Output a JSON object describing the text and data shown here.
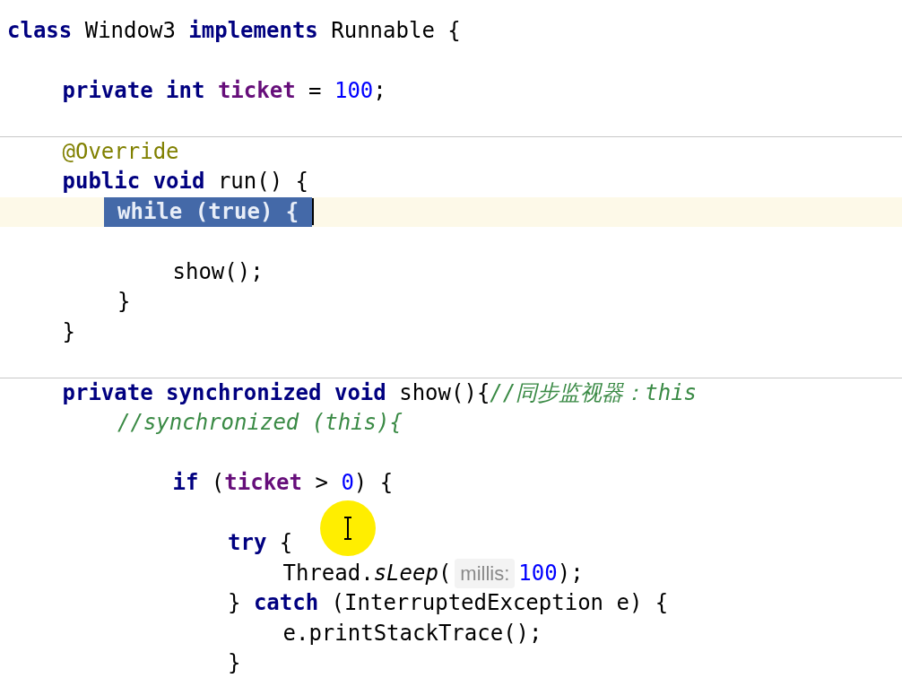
{
  "editor": {
    "lines": [
      {
        "current": false,
        "separator": false,
        "tokens": [
          {
            "t": "class",
            "kind": "keyword"
          },
          {
            "t": " Window3 ",
            "kind": "plain"
          },
          {
            "t": "implements",
            "kind": "keyword"
          },
          {
            "t": " Runnable {",
            "kind": "plain"
          }
        ],
        "children": [
          {
            "current": false,
            "separator": false
          },
          {
            "current": false,
            "separator": false,
            "tokens": [
              {
                "t": "private int ",
                "kind": "keyword"
              },
              {
                "t": "ticket",
                "kind": "field"
              },
              {
                "t": " = ",
                "kind": "plain"
              },
              {
                "t": "100",
                "kind": "number"
              },
              {
                "t": ";",
                "kind": "plain"
              }
            ]
          },
          {
            "current": false,
            "separator": false
          },
          {
            "current": false,
            "separator": true,
            "tokens": [
              {
                "t": "@Override",
                "kind": "annotation"
              }
            ]
          },
          {
            "current": false,
            "separator": false,
            "tokens": [
              {
                "t": "public void",
                "kind": "keyword"
              },
              {
                "t": " run() {",
                "kind": "plain"
              }
            ],
            "children": [
              {
                "current": true,
                "separator": false,
                "tokens": [
                  {
                    "t": "while (true) {",
                    "kind": "selected"
                  }
                ],
                "children": [
                  {
                    "current": false,
                    "separator": false
                  },
                  {
                    "current": false,
                    "separator": false,
                    "tokens": [
                      {
                        "t": "show();",
                        "kind": "plain"
                      }
                    ]
                  }
                ]
              },
              {
                "current": false,
                "separator": false,
                "tokens": [
                  {
                    "t": "}",
                    "kind": "plain"
                  }
                ]
              }
            ]
          },
          {
            "current": false,
            "separator": false,
            "tokens": [
              {
                "t": "}",
                "kind": "plain"
              }
            ]
          },
          {
            "current": false,
            "separator": false
          },
          {
            "current": false,
            "separator": true,
            "tokens": [
              {
                "t": "private synchronized void",
                "kind": "keyword"
              },
              {
                "t": " show(){",
                "kind": "plain"
              },
              {
                "t": "//同步监视器：this",
                "kind": "comment"
              }
            ],
            "children": [
              {
                "current": false,
                "separator": false,
                "tokens": [
                  {
                    "t": "//synchronized (this){",
                    "kind": "comment"
                  }
                ],
                "children": [
                  {
                    "current": false,
                    "separator": false
                  },
                  {
                    "current": false,
                    "separator": false,
                    "tokens": [
                      {
                        "t": "if",
                        "kind": "keyword"
                      },
                      {
                        "t": " (",
                        "kind": "plain"
                      },
                      {
                        "t": "ticket",
                        "kind": "field"
                      },
                      {
                        "t": " > ",
                        "kind": "plain"
                      },
                      {
                        "t": "0",
                        "kind": "number"
                      },
                      {
                        "t": ") {",
                        "kind": "plain"
                      }
                    ],
                    "children": [
                      {
                        "current": false,
                        "separator": false
                      },
                      {
                        "current": false,
                        "separator": false,
                        "tokens": [
                          {
                            "t": "try",
                            "kind": "keyword"
                          },
                          {
                            "t": " {",
                            "kind": "plain"
                          }
                        ],
                        "children": [
                          {
                            "current": false,
                            "separator": false,
                            "tokens": [
                              {
                                "t": "Thread.",
                                "kind": "plain"
                              },
                              {
                                "t": "sLeep",
                                "kind": "method"
                              },
                              {
                                "t": "(",
                                "kind": "plain"
                              },
                              {
                                "t": "millis:",
                                "kind": "hint"
                              },
                              {
                                "t": "100",
                                "kind": "number"
                              },
                              {
                                "t": ");",
                                "kind": "plain"
                              }
                            ]
                          }
                        ]
                      },
                      {
                        "current": false,
                        "separator": false,
                        "tokens": [
                          {
                            "t": "} ",
                            "kind": "plain"
                          },
                          {
                            "t": "catch",
                            "kind": "keyword"
                          },
                          {
                            "t": " (InterruptedException e) {",
                            "kind": "plain"
                          }
                        ],
                        "children": [
                          {
                            "current": false,
                            "separator": false,
                            "tokens": [
                              {
                                "t": "e.printStackTrace();",
                                "kind": "plain"
                              }
                            ]
                          }
                        ]
                      },
                      {
                        "current": false,
                        "separator": false,
                        "tokens": [
                          {
                            "t": "}",
                            "kind": "plain"
                          }
                        ]
                      }
                    ]
                  }
                ]
              }
            ]
          }
        ]
      }
    ]
  }
}
